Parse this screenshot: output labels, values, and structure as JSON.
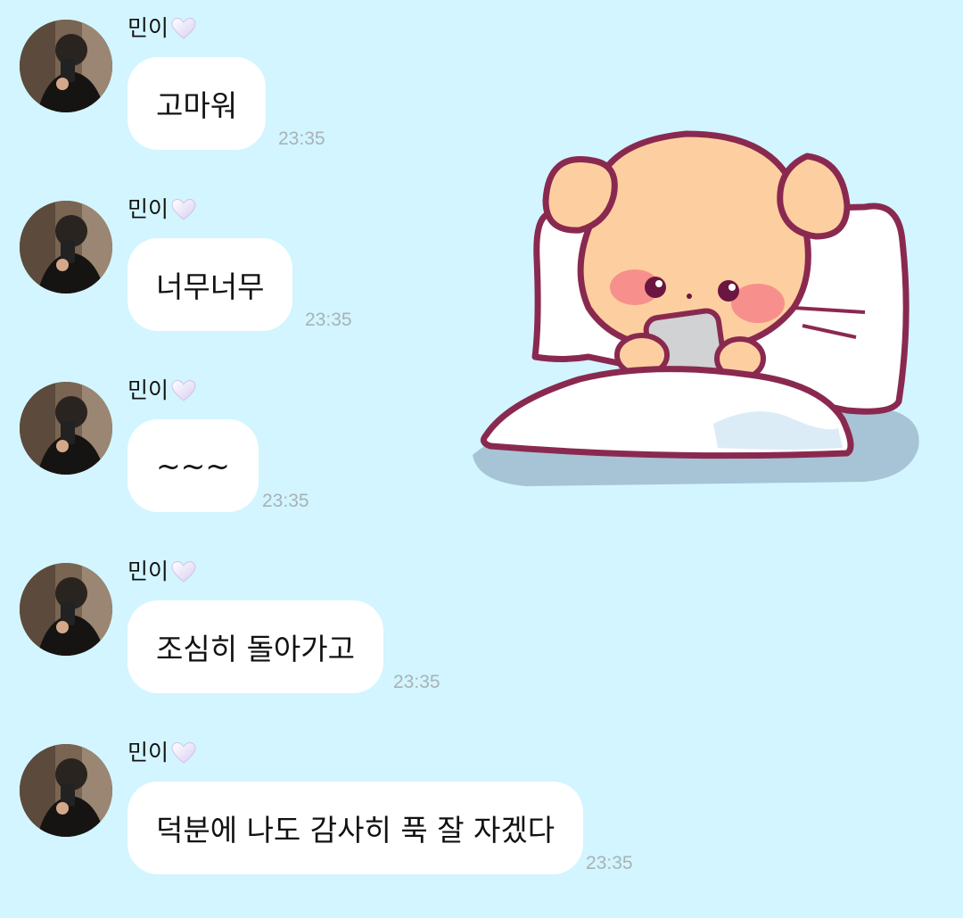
{
  "chat": {
    "sender_name": "민이",
    "messages": [
      {
        "text": "고마워",
        "time": "23:35"
      },
      {
        "text": "너무너무",
        "time": "23:35"
      },
      {
        "text": "~~~",
        "time": "23:35"
      },
      {
        "text": "조심히 돌아가고",
        "time": "23:35"
      },
      {
        "text": "덕분에 나도 감사히 푹 잘 자겠다",
        "time": "23:35"
      }
    ]
  },
  "icons": {
    "heart": "heart-icon",
    "sticker": "puppy-in-bed-with-phone-sticker"
  },
  "colors": {
    "background": "#d2f5ff",
    "bubble": "#ffffff",
    "time": "#a9b2b6"
  }
}
